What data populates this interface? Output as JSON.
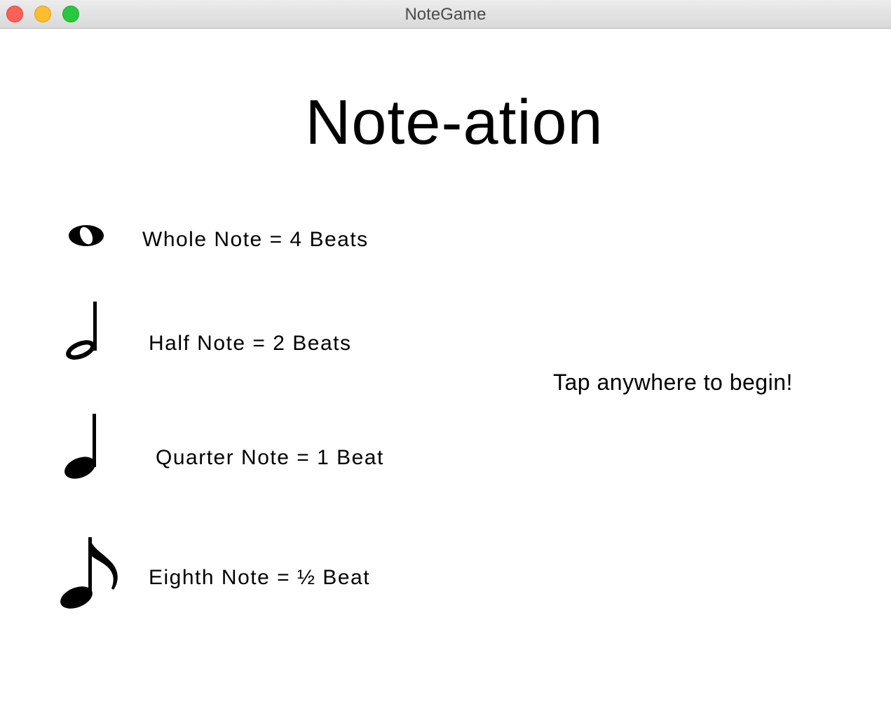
{
  "window": {
    "title": "NoteGame"
  },
  "app": {
    "title": "Note-ation",
    "prompt": "Tap anywhere to begin!"
  },
  "notes": [
    {
      "icon": "whole-note-icon",
      "label": "Whole Note = 4 Beats"
    },
    {
      "icon": "half-note-icon",
      "label": "Half Note = 2 Beats"
    },
    {
      "icon": "quarter-note-icon",
      "label": "Quarter Note = 1 Beat"
    },
    {
      "icon": "eighth-note-icon",
      "label": "Eighth Note = ½ Beat"
    }
  ],
  "colors": {
    "close": "#fe5f57",
    "minimize": "#febc2e",
    "zoom": "#28c840",
    "background": "#ffffff",
    "text": "#000000"
  }
}
